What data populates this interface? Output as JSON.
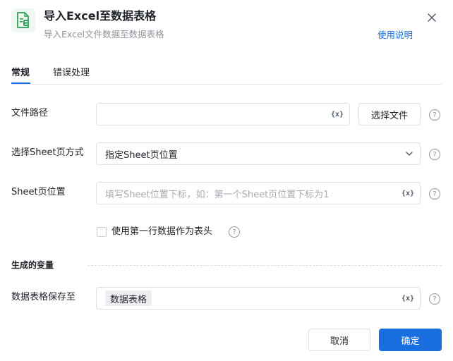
{
  "header": {
    "title": "导入Excel至数据表格",
    "subtitle": "导入Excel文件数据至数据表格",
    "help_link": "使用说明",
    "app_icon": "excel-file-icon",
    "close_icon": "close-icon"
  },
  "tabs": [
    {
      "label": "常规",
      "active": true
    },
    {
      "label": "错误处理",
      "active": false
    }
  ],
  "form": {
    "file_path": {
      "label": "文件路径",
      "value": "",
      "variable_icon": "{x}",
      "button_label": "选择文件"
    },
    "sheet_mode": {
      "label": "选择Sheet页方式",
      "value": "指定Sheet页位置"
    },
    "sheet_position": {
      "label": "Sheet页位置",
      "placeholder": "填写Sheet位置下标，如：第一个Sheet页位置下标为1",
      "variable_icon": "{x}"
    },
    "first_row_header": {
      "label": "使用第一行数据作为表头",
      "checked": false
    }
  },
  "output": {
    "section_title": "生成的变量",
    "save_to": {
      "label": "数据表格保存至",
      "tag": "数据表格",
      "variable_icon": "{x}"
    }
  },
  "footer": {
    "cancel_label": "取消",
    "confirm_label": "确定"
  },
  "help_glyph": "?",
  "colors": {
    "accent": "#1a6fe0",
    "icon_green": "#2ea05b"
  }
}
